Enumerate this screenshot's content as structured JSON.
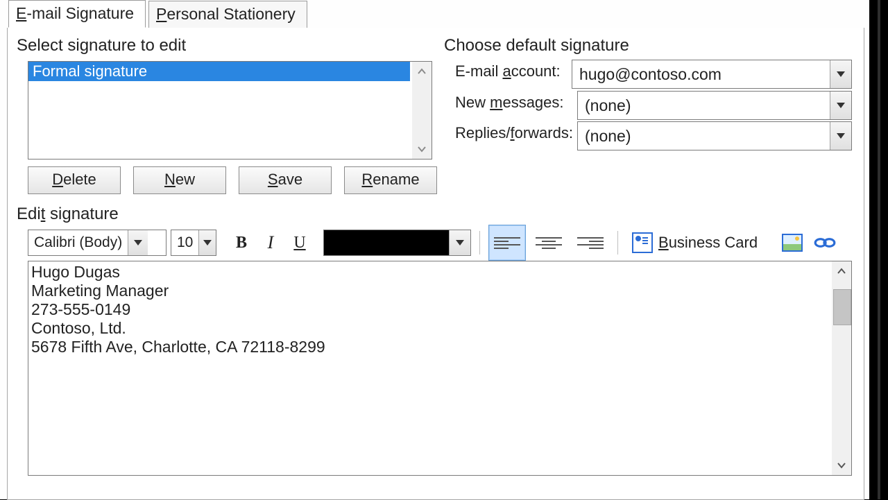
{
  "tabs": {
    "email_signature": "E-mail Signature",
    "personal_stationery": "Personal Stationery"
  },
  "left": {
    "select_label": "Select signature to edit",
    "signature_items": [
      "Formal signature"
    ],
    "buttons": {
      "delete": "Delete",
      "new": "New",
      "save": "Save",
      "rename": "Rename"
    }
  },
  "right": {
    "default_label": "Choose default signature",
    "email_account_label": "E-mail account:",
    "email_account_value": "hugo@contoso.com",
    "new_messages_label": "New messages:",
    "new_messages_value": "(none)",
    "replies_label": "Replies/forwards:",
    "replies_value": "(none)"
  },
  "edit": {
    "label": "Edit signature",
    "font": "Calibri (Body)",
    "size": "10",
    "business_card": "Business Card",
    "content": "Hugo Dugas\nMarketing Manager\n273-555-0149\nContoso, Ltd.\n5678 Fifth Ave, Charlotte, CA 72118-8299"
  }
}
